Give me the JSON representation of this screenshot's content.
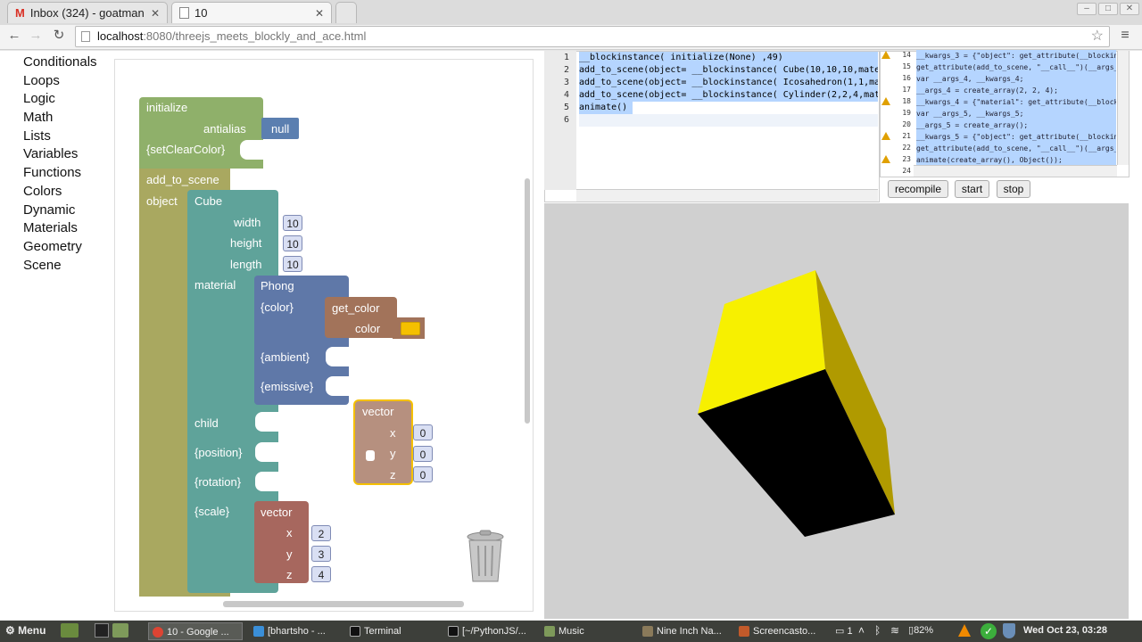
{
  "browser": {
    "tabs": [
      {
        "title": "Inbox (324) - goatman"
      },
      {
        "title": "10"
      }
    ],
    "url_host": "localhost",
    "url_path": ":8080/threejs_meets_blockly_and_ace.html"
  },
  "toolbox": {
    "categories": [
      "Conditionals",
      "Loops",
      "Logic",
      "Math",
      "Lists",
      "Variables",
      "Functions",
      "Colors",
      "Dynamic",
      "Materials",
      "Geometry",
      "Scene"
    ]
  },
  "blocks": {
    "initialize": {
      "title": "initialize",
      "antialias": "antialias",
      "antialias_value": "null",
      "clear_color": "{setClearColor}"
    },
    "add_to_scene": {
      "title": "add_to_scene",
      "object": "object"
    },
    "cube": {
      "title": "Cube",
      "width": "width",
      "width_value": "10",
      "height": "height",
      "height_value": "10",
      "length": "length",
      "length_value": "10",
      "material": "material",
      "child": "child",
      "position": "{position}",
      "rotation": "{rotation}",
      "scale": "{scale}"
    },
    "phong": {
      "title": "Phong",
      "color": "{color}",
      "ambient": "{ambient}",
      "emissive": "{emissive}"
    },
    "get_color": {
      "title": "get_color",
      "color": "color",
      "swatch": "#f5c000"
    },
    "vector_float": {
      "title": "vector",
      "x": "x",
      "x_value": "0",
      "y": "y",
      "y_value": "0",
      "z": "z",
      "z_value": "0"
    },
    "vector_scale": {
      "title": "vector",
      "x": "x",
      "x_value": "2",
      "y": "y",
      "y_value": "3",
      "z": "z",
      "z_value": "4"
    }
  },
  "editor": {
    "line_numbers": [
      "1",
      "2",
      "3",
      "4",
      "5",
      "6"
    ],
    "lines": [
      "__blockinstance(  initialize(None)  ,49)",
      "add_to_scene(object=  __blockinstance(  Cube(10,10,10,materi",
      "add_to_scene(object=  __blockinstance(  Icosahedron(1,1,mate",
      "add_to_scene(object=  __blockinstance(  Cylinder(2,2,4,mater",
      "animate()",
      ""
    ]
  },
  "editor2": {
    "line_numbers": [
      "14",
      "15",
      "16",
      "17",
      "18",
      "19",
      "20",
      "21",
      "22",
      "23",
      "24"
    ],
    "lines": [
      "__kwargs_3 = {\"object\": get_attribute(__blockins",
      "get_attribute(add_to_scene, \"__call__\")(__args_3",
      "var __args_4, __kwargs_4;",
      "__args_4 = create_array(2, 2, 4);",
      "__kwargs_4 = {\"material\": get_attribute(__blocki",
      "var __args_5, __kwargs_5;",
      "__args_5 = create_array();",
      "__kwargs_5 = {\"object\": get_attribute(__blockins",
      "get_attribute(add_to_scene, \"__call__\")(__args_5",
      "animate(create_array(), Object());",
      ""
    ]
  },
  "controls": {
    "recompile": "recompile",
    "start": "start",
    "stop": "stop"
  },
  "colors": {
    "cube_top": "#f7f000",
    "cube_side": "#b09a00",
    "cube_front": "#000000",
    "viewport_bg": "#d0d0d0"
  },
  "taskbar": {
    "menu": "Menu",
    "tasks": [
      "10 - Google ...",
      "[bhartsho - ...",
      "Terminal",
      "[~/PythonJS/...",
      "Music",
      "Nine Inch Na...",
      "Screencasto..."
    ],
    "workspace": "1",
    "battery": "82%",
    "clock": "Wed Oct 23, 03:28"
  }
}
